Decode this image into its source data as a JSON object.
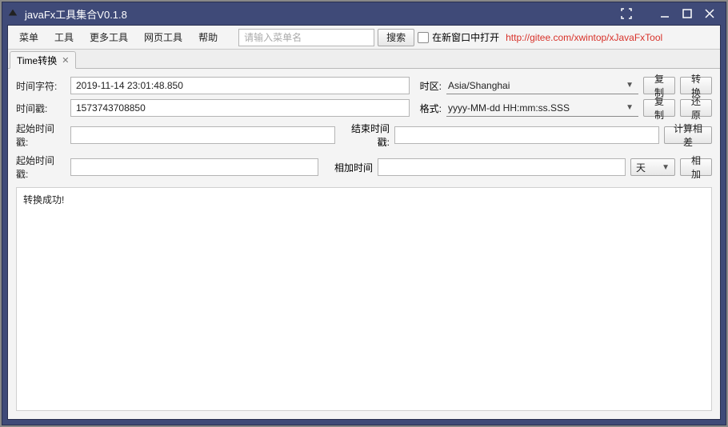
{
  "window": {
    "title": "javaFx工具集合V0.1.8"
  },
  "menubar": {
    "items": [
      "菜单",
      "工具",
      "更多工具",
      "网页工具",
      "帮助"
    ],
    "search_placeholder": "请输入菜单名",
    "search_button": "搜索",
    "checkbox_label": "在新窗口中打开",
    "link": "http://gitee.com/xwintop/xJavaFxTool"
  },
  "tab": {
    "label": "Time转换"
  },
  "form": {
    "time_string_label": "时间字符:",
    "time_string_value": "2019-11-14 23:01:48.850",
    "timezone_label": "时区:",
    "timezone_value": "Asia/Shanghai",
    "copy": "复制",
    "convert": "转换",
    "timestamp_label": "时间戳:",
    "timestamp_value": "1573743708850",
    "format_label": "格式:",
    "format_value": "yyyy-MM-dd HH:mm:ss.SSS",
    "restore": "还原",
    "start_ts_label": "起始时间戳:",
    "end_ts_label": "结束时间戳:",
    "calc_diff": "计算相差",
    "start_ts_label2": "起始时间戳:",
    "add_time_label": "相加时间",
    "unit_value": "天",
    "add_button": "相加"
  },
  "status": "转换成功!"
}
